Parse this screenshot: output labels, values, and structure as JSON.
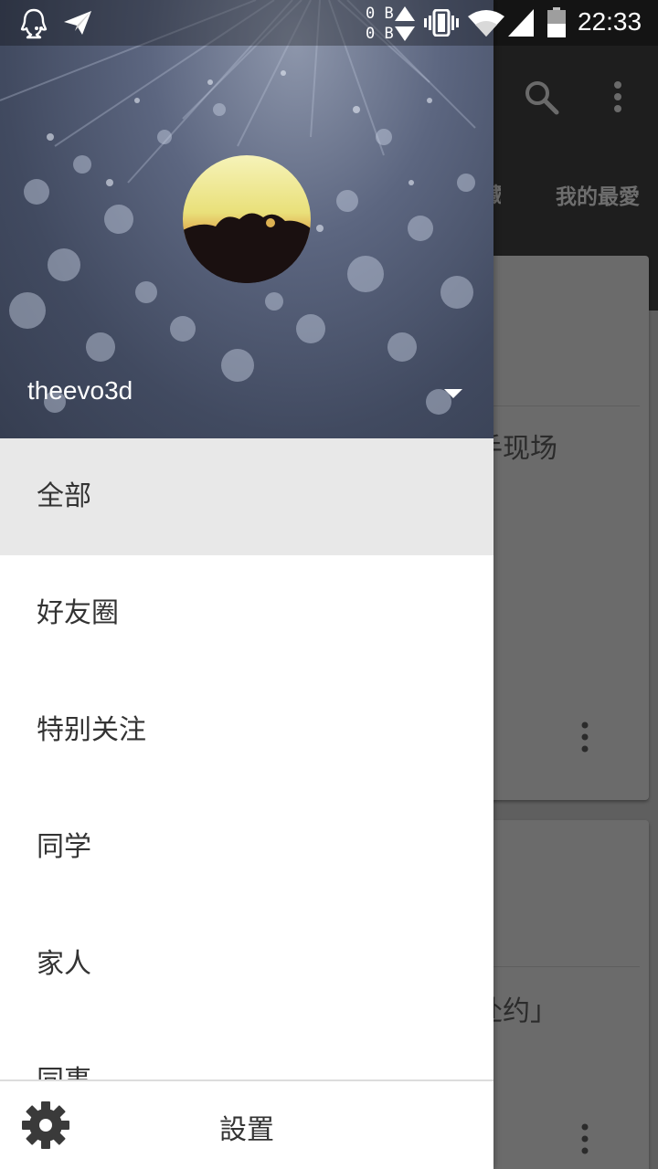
{
  "status_bar": {
    "traffic_up": "0 B",
    "traffic_down": "0 B",
    "time": "22:33",
    "icons": [
      "qq-icon",
      "send-icon",
      "vibrate-icon",
      "wifi-icon",
      "signal-icon",
      "battery-icon"
    ]
  },
  "background_app": {
    "tab_partial": "藏",
    "tab_favorites": "我的最愛",
    "card1_text": "手现场",
    "card2_text": "赴约」",
    "icons": [
      "search-icon",
      "more-vert-icon"
    ]
  },
  "drawer": {
    "username": "theevo3d",
    "menu_items": [
      {
        "label": "全部",
        "selected": true
      },
      {
        "label": "好友圈",
        "selected": false
      },
      {
        "label": "特别关注",
        "selected": false
      },
      {
        "label": "同学",
        "selected": false
      },
      {
        "label": "家人",
        "selected": false
      },
      {
        "label": "同事",
        "selected": false
      }
    ],
    "footer": {
      "settings_label": "設置",
      "icon": "gear-icon"
    }
  },
  "colors": {
    "drawer_bg": "#ffffff",
    "selected_item_bg": "#e8e8e8",
    "menu_text": "#333333",
    "scrim": "#5f5f5f",
    "toolbar": "#1e1e1e"
  }
}
